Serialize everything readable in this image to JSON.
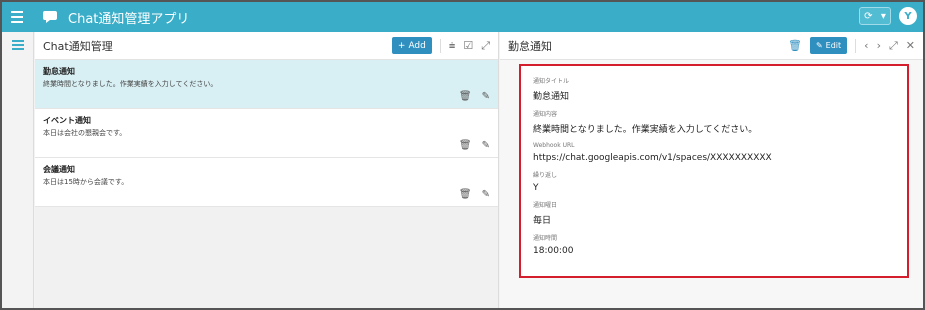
{
  "app": {
    "title": "Chat通知管理アプリ",
    "avatar": "Y"
  },
  "list_panel": {
    "title": "Chat通知管理",
    "add_label": "Add",
    "items": [
      {
        "title": "勤怠通知",
        "body": "終業時間となりました。作業実績を入力してください。",
        "selected": true
      },
      {
        "title": "イベント通知",
        "body": "本日は会社の懇親会です。",
        "selected": false
      },
      {
        "title": "会議通知",
        "body": "本日は15時から会議です。",
        "selected": false
      }
    ]
  },
  "detail_panel": {
    "title": "勤怠通知",
    "edit_label": "Edit",
    "fields": [
      {
        "label": "通知タイトル",
        "value": "勤怠通知"
      },
      {
        "label": "通知内容",
        "value": "終業時間となりました。作業実績を入力してください。"
      },
      {
        "label": "Webhook URL",
        "value": "https://chat.googleapis.com/v1/spaces/XXXXXXXXXX"
      },
      {
        "label": "繰り返し",
        "value": "Y"
      },
      {
        "label": "通知曜日",
        "value": "毎日"
      },
      {
        "label": "通知時間",
        "value": "18:00:00"
      }
    ]
  },
  "colors": {
    "accent": "#3aaec8",
    "button": "#2f8fbf",
    "highlight_border": "#d41e2e",
    "selected_row": "#d8eff3"
  }
}
